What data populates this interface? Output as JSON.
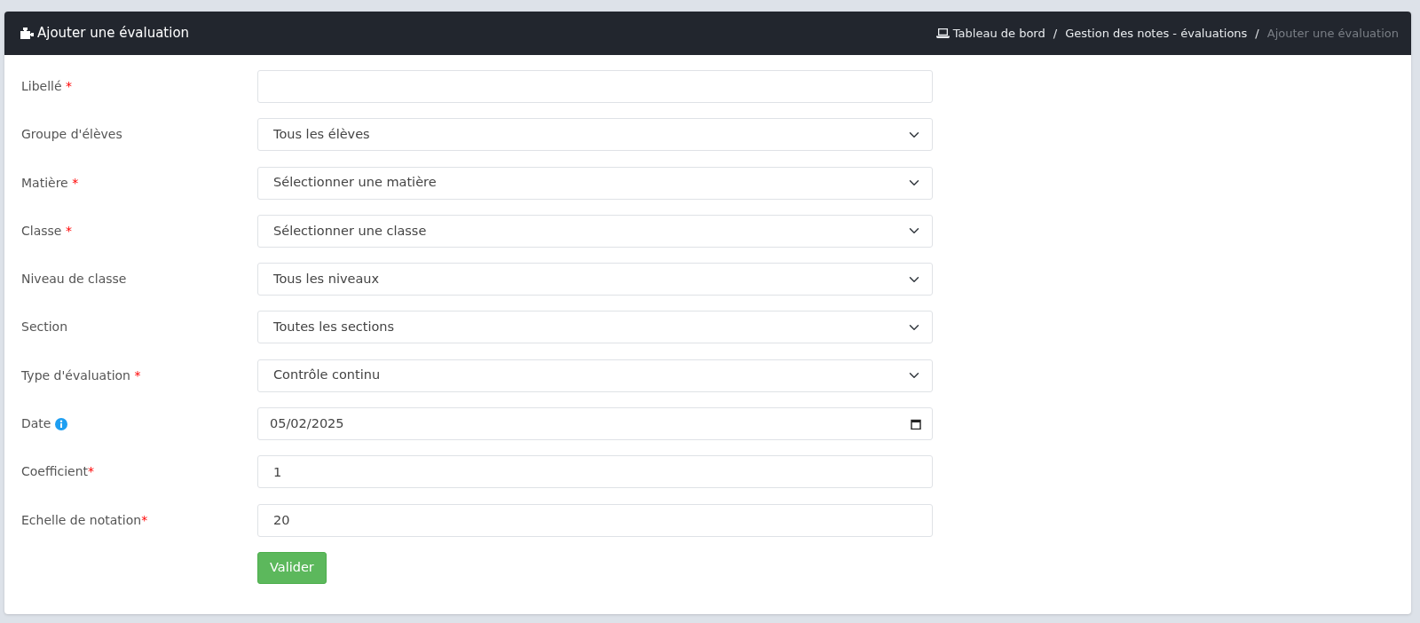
{
  "header": {
    "title": "Ajouter une évaluation",
    "breadcrumb": [
      {
        "label": "Tableau de bord",
        "current": false
      },
      {
        "separator": "/",
        "label": "Gestion des notes - évaluations",
        "current": false
      },
      {
        "separator": "/",
        "label": "Ajouter une évaluation",
        "current": true
      }
    ]
  },
  "fields": [
    {
      "label": "Libellé",
      "marker": " *",
      "kind": "text"
    },
    {
      "label": "Groupe d'élèves",
      "kind": "select",
      "value": "Tous les élèves"
    },
    {
      "label": "Matière",
      "marker": " *",
      "kind": "select",
      "value": "Sélectionner une matière"
    },
    {
      "label": "Classe",
      "marker": " *",
      "kind": "select",
      "value": "Sélectionner une classe"
    },
    {
      "label": "Niveau de classe",
      "kind": "select",
      "value": "Tous les niveaux"
    },
    {
      "label": "Section",
      "kind": "select",
      "value": "Toutes les sections"
    },
    {
      "label": "Type d'évaluation",
      "marker": " *",
      "kind": "select",
      "value": "Contrôle continu"
    },
    {
      "label": "Date",
      "info": true,
      "kind": "date",
      "value": "05/02/2025"
    },
    {
      "label": "Coefficient",
      "marker": "*",
      "kind": "text",
      "value": "1"
    },
    {
      "label": "Echelle de notation",
      "marker": "*",
      "kind": "text",
      "value": "20"
    }
  ],
  "submit": {
    "label": "Valider"
  }
}
